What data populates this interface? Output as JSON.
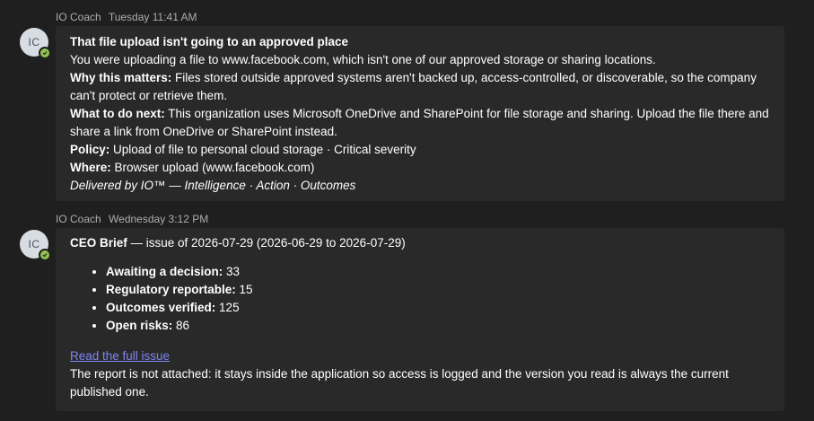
{
  "messages": [
    {
      "sender": "IO Coach",
      "timestamp": "Tuesday 11:41 AM",
      "avatar_initials": "IC",
      "presence": "available",
      "title": "That file upload isn't going to an approved place",
      "intro": "You were uploading a file to www.facebook.com, which isn't one of our approved storage or sharing locations.",
      "why_label": "Why this matters:",
      "why_text": " Files stored outside approved systems aren't backed up, access-controlled, or discoverable, so the company can't protect or retrieve them.",
      "next_label": "What to do next:",
      "next_text": " This organization uses Microsoft OneDrive and SharePoint for file storage and sharing. Upload the file there and share a link from OneDrive or SharePoint instead.",
      "policy_label": "Policy:",
      "policy_text": " Upload of file to personal cloud storage · Critical severity",
      "where_label": "Where:",
      "where_text": " Browser upload (www.facebook.com)",
      "footer": "Delivered by IO™ — Intelligence · Action · Outcomes"
    },
    {
      "sender": "IO Coach",
      "timestamp": "Wednesday 3:12 PM",
      "avatar_initials": "IC",
      "presence": "available",
      "title": "CEO Brief",
      "subtitle": " — issue of 2026-07-29 (2026-06-29 to 2026-07-29)",
      "stats": [
        {
          "label": "Awaiting a decision:",
          "value": " 33"
        },
        {
          "label": "Regulatory reportable:",
          "value": " 15"
        },
        {
          "label": "Outcomes verified:",
          "value": " 125"
        },
        {
          "label": "Open risks:",
          "value": " 86"
        }
      ],
      "link_text": "Read the full issue",
      "note": "The report is not attached: it stays inside the application so access is logged and the version you read is always the current published one."
    }
  ],
  "colors": {
    "background": "#1f1f1f",
    "bubble": "#292929",
    "link": "#7f85f5",
    "presence": "#92c353",
    "meta_text": "#adadad"
  }
}
